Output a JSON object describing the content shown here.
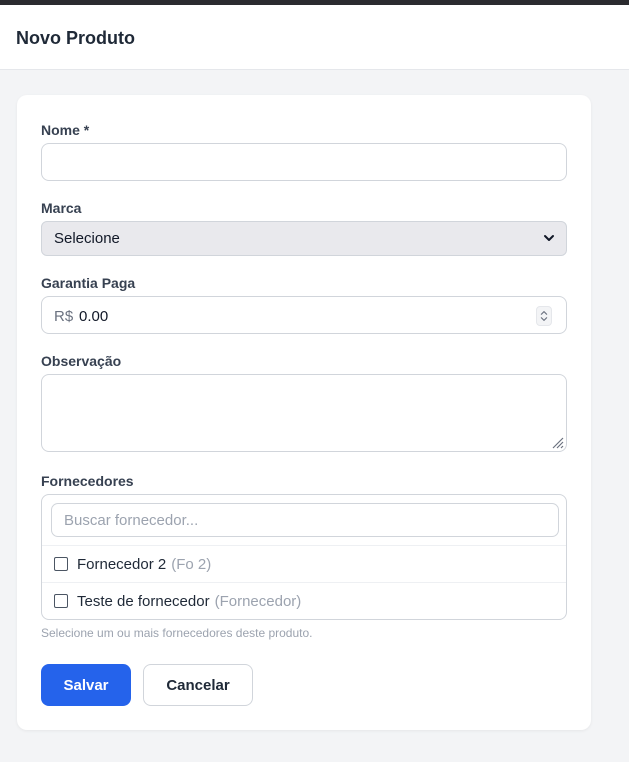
{
  "header": {
    "title": "Novo Produto"
  },
  "form": {
    "name": {
      "label": "Nome *",
      "value": ""
    },
    "brand": {
      "label": "Marca",
      "selected": "Selecione"
    },
    "warranty": {
      "label": "Garantia Paga",
      "prefix": "R$",
      "value": "0.00"
    },
    "notes": {
      "label": "Observação",
      "value": ""
    },
    "suppliers": {
      "label": "Fornecedores",
      "search_placeholder": "Buscar fornecedor...",
      "items": [
        {
          "name": "Fornecedor 2",
          "code": "(Fo 2)",
          "checked": false
        },
        {
          "name": "Teste de fornecedor",
          "code": "(Fornecedor)",
          "checked": false
        }
      ],
      "help": "Selecione um ou mais fornecedores deste produto."
    },
    "actions": {
      "save": "Salvar",
      "cancel": "Cancelar"
    }
  },
  "colors": {
    "primary": "#2563eb",
    "background": "#f3f4f6",
    "topbar": "#2b2b2f"
  }
}
